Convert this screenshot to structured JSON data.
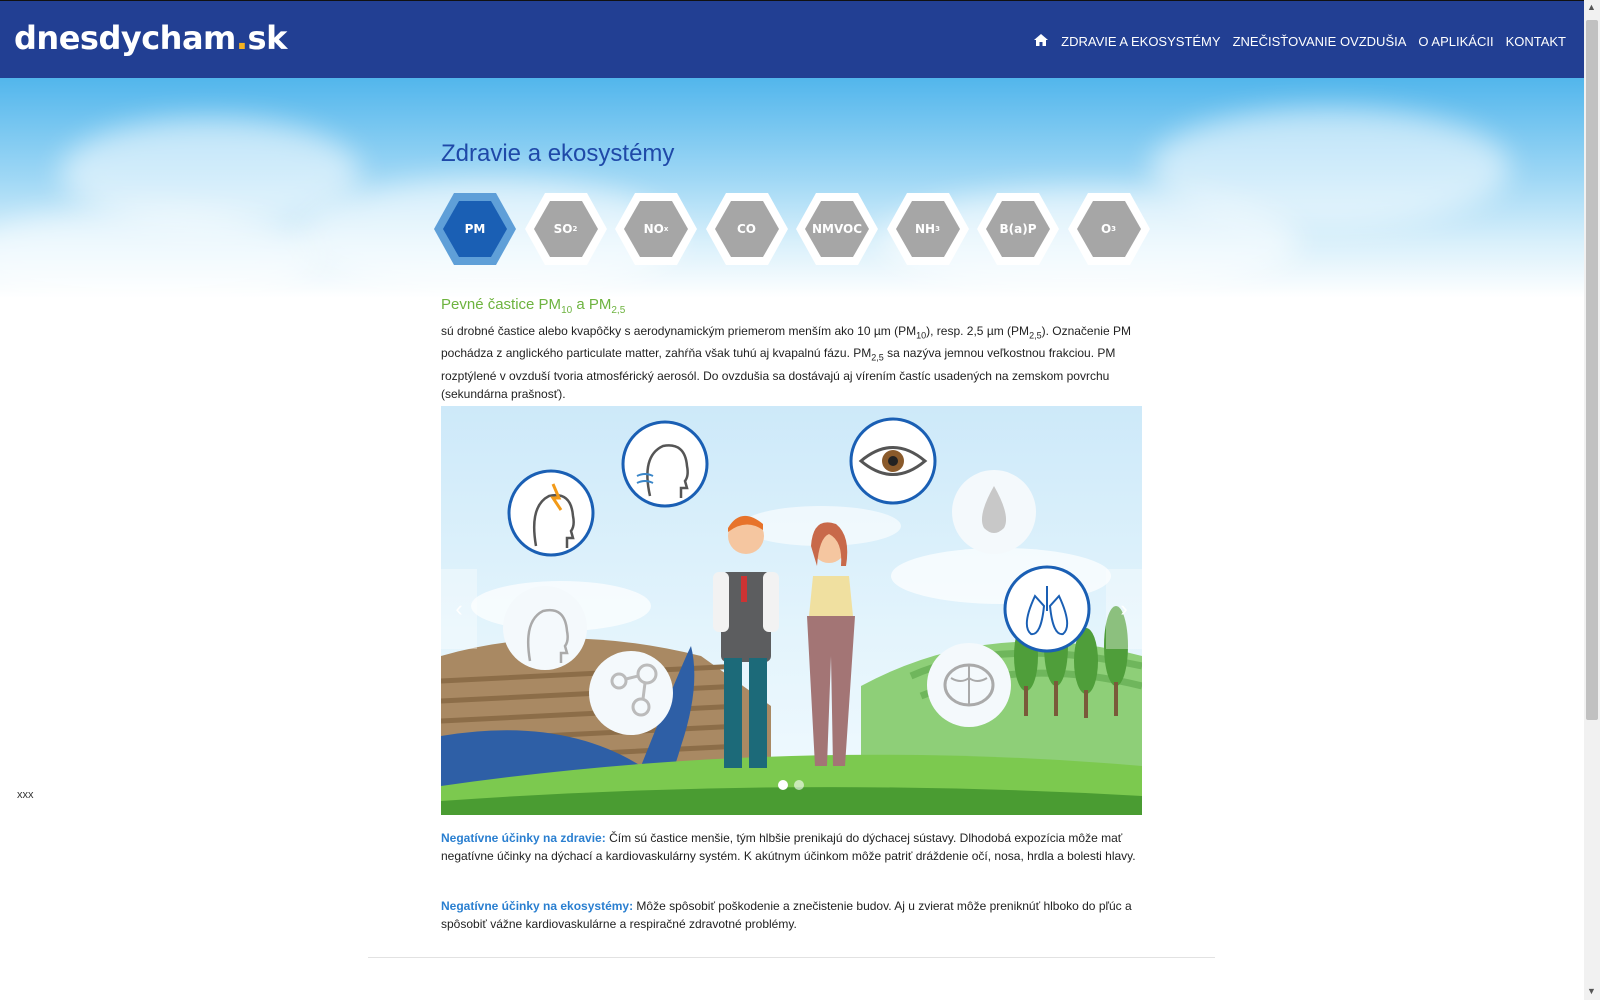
{
  "header": {
    "logo_main": "dnesdycham",
    "logo_dot": ".",
    "logo_tld": "sk",
    "nav": [
      {
        "label": "ZDRAVIE A EKOSYSTÉMY"
      },
      {
        "label": "ZNEČISŤOVANIE OVZDUŠIA"
      },
      {
        "label": "O APLIKÁCII"
      },
      {
        "label": "KONTAKT"
      }
    ]
  },
  "page": {
    "title": "Zdravie a ekosystémy"
  },
  "pollutants": [
    {
      "label": "PM",
      "sub": "",
      "active": true
    },
    {
      "label": "SO",
      "sub": "2",
      "active": false
    },
    {
      "label": "NO",
      "sub": "x",
      "active": false
    },
    {
      "label": "CO",
      "sub": "",
      "active": false
    },
    {
      "label": "NMVOC",
      "sub": "",
      "active": false
    },
    {
      "label": "NH",
      "sub": "3",
      "active": false
    },
    {
      "label": "B(a)P",
      "sub": "",
      "active": false
    },
    {
      "label": "O",
      "sub": "3",
      "active": false
    }
  ],
  "section": {
    "heading_a": "Pevné častice PM",
    "heading_sub_a": "10",
    "heading_mid": " a PM",
    "heading_sub_b": "2,5",
    "intro_1": "sú drobné častice alebo kvapôčky s aerodynamickým priemerom menším ako 10 µm (PM",
    "intro_sub_1": "10",
    "intro_2": "), resp. 2,5 µm (PM",
    "intro_sub_2": "2,5",
    "intro_3": "). Označenie PM pochádza z anglického particulate matter, zahŕňa však tuhú aj kvapalnú fázu. PM",
    "intro_sub_3": "2,5",
    "intro_4": " sa nazýva jemnou veľkostnou frakciou. PM rozptýlené v ovzduší tvoria atmosférický aerosól. Do ovzdušia sa dostávajú aj vírením častíc usadených na zemskom povrchu (sekundárna prašnosť)."
  },
  "carousel": {
    "prev_glyph": "‹",
    "next_glyph": "›",
    "slides": 2,
    "active_slide": 0
  },
  "effects": {
    "health_lead": "Negatívne účinky na zdravie:",
    "health_text": " Čím sú častice menšie, tým hlbšie prenikajú do dýchacej sústavy. Dlhodobá expozícia môže mať negatívne účinky na dýchací a kardiovaskulárny systém. K akútnym účinkom môže patriť dráždenie očí, nosa, hrdla a bolesti hlavy.",
    "eco_lead": "Negatívne účinky na ekosystémy:",
    "eco_text": " Môže spôsobiť poškodenie a znečistenie budov. Aj u zvierat môže preniknúť hlboko do pľúc a spôsobiť vážne kardiovaskulárne a respiračné zdravotné problémy."
  },
  "side_note": "xxx",
  "colors": {
    "header_bg": "#223f93",
    "active_hex": "#1a5fb4",
    "inactive_hex": "#a6a6a6",
    "heading_green": "#6db33f",
    "lead_blue": "#2a7fd0"
  }
}
